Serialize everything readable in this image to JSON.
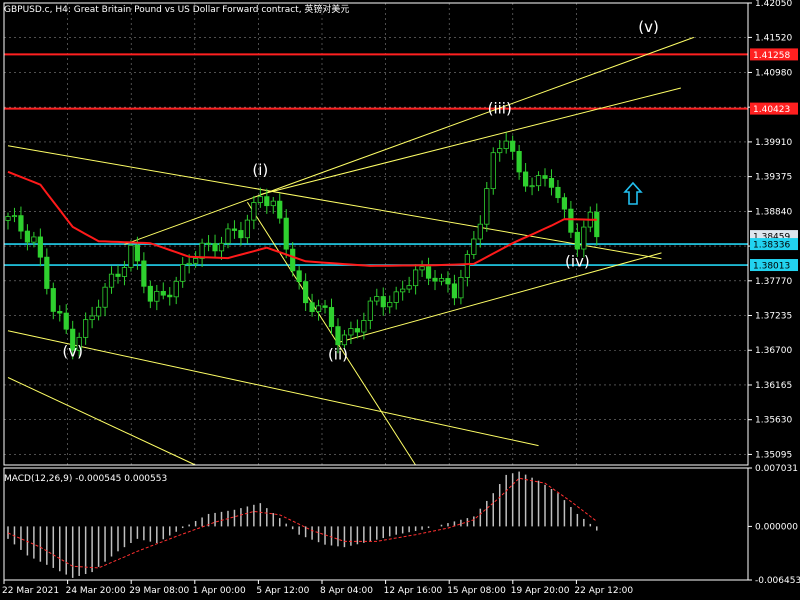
{
  "header": {
    "title": "GBPUSD.c, H4:  Great Britain Pound vs US Dollar Forward contract, 英镑对美元"
  },
  "colors": {
    "background": "#000000",
    "grid": "#7f7f7f",
    "up_candle": "#2fd02f",
    "down_candle": "#2fd02f",
    "moving_average": "#ff1a1a",
    "trendline": "#ffff66",
    "resistance": "#ff2020",
    "support": "#22d3f0",
    "text": "#ffffff",
    "macd_hist": "#c0c0c0",
    "macd_signal": "#ff3030",
    "arrow": "#22c0f0"
  },
  "macd": {
    "label": "MACD(12,26,9) -0.000545 0.000553",
    "ticks": [
      "0.007031",
      "0.000000",
      "-0.006453"
    ]
  },
  "icons": {
    "up_arrow": "up-arrow-icon"
  },
  "chart_data": {
    "type": "candlestick",
    "symbol": "GBPUSD.c",
    "timeframe": "H4",
    "ylim": [
      1.34932,
      1.4205
    ],
    "y_ticks": [
      "1.42050",
      "1.41520",
      "1.40980",
      "1.40445",
      "1.39910",
      "1.39375",
      "1.38840",
      "1.38305",
      "1.37770",
      "1.37235",
      "1.36700",
      "1.36165",
      "1.35630",
      "1.35095"
    ],
    "x_ticks": [
      "22 Mar 2021",
      "24 Mar 20:00",
      "29 Mar 08:00",
      "1 Apr 00:00",
      "5 Apr 12:00",
      "8 Apr 04:00",
      "12 Apr 16:00",
      "15 Apr 08:00",
      "19 Apr 20:00",
      "22 Apr 12:00"
    ],
    "price_labels": [
      {
        "value": 1.41258,
        "text": "1.41258",
        "kind": "resistance"
      },
      {
        "value": 1.40423,
        "text": "1.40423",
        "kind": "resistance"
      },
      {
        "value": 1.38459,
        "text": "1.38459",
        "kind": "current"
      },
      {
        "value": 1.38336,
        "text": "1.38336",
        "kind": "support"
      },
      {
        "value": 1.38013,
        "text": "1.38013",
        "kind": "support"
      }
    ],
    "wave_labels": [
      {
        "text": "(v)",
        "bar": 10,
        "price": 1.366
      },
      {
        "text": "(i)",
        "bar": 39,
        "price": 1.394
      },
      {
        "text": "(ii)",
        "bar": 51,
        "price": 1.3656
      },
      {
        "text": "(iii)",
        "bar": 76,
        "price": 1.4035
      },
      {
        "text": "(iv)",
        "bar": 88,
        "price": 1.3799
      },
      {
        "text": "(v)",
        "bar": 99,
        "price": 1.416
      }
    ],
    "anchors": [
      {
        "bar": 0,
        "price": 1.387
      },
      {
        "bar": 4,
        "price": 1.3845
      },
      {
        "bar": 7,
        "price": 1.373
      },
      {
        "bar": 10,
        "price": 1.3685
      },
      {
        "bar": 13,
        "price": 1.372
      },
      {
        "bar": 16,
        "price": 1.378
      },
      {
        "bar": 19,
        "price": 1.3825
      },
      {
        "bar": 22,
        "price": 1.3745
      },
      {
        "bar": 26,
        "price": 1.3775
      },
      {
        "bar": 30,
        "price": 1.383
      },
      {
        "bar": 33,
        "price": 1.384
      },
      {
        "bar": 36,
        "price": 1.385
      },
      {
        "bar": 39,
        "price": 1.3915
      },
      {
        "bar": 41,
        "price": 1.389
      },
      {
        "bar": 44,
        "price": 1.38
      },
      {
        "bar": 46,
        "price": 1.3745
      },
      {
        "bar": 48,
        "price": 1.3735
      },
      {
        "bar": 51,
        "price": 1.369
      },
      {
        "bar": 54,
        "price": 1.3705
      },
      {
        "bar": 57,
        "price": 1.3745
      },
      {
        "bar": 60,
        "price": 1.3755
      },
      {
        "bar": 63,
        "price": 1.3785
      },
      {
        "bar": 66,
        "price": 1.379
      },
      {
        "bar": 69,
        "price": 1.3755
      },
      {
        "bar": 71,
        "price": 1.3805
      },
      {
        "bar": 73,
        "price": 1.388
      },
      {
        "bar": 75,
        "price": 1.3965
      },
      {
        "bar": 77,
        "price": 1.3995
      },
      {
        "bar": 79,
        "price": 1.394
      },
      {
        "bar": 82,
        "price": 1.393
      },
      {
        "bar": 84,
        "price": 1.3925
      },
      {
        "bar": 86,
        "price": 1.388
      },
      {
        "bar": 88,
        "price": 1.384
      },
      {
        "bar": 90,
        "price": 1.387
      },
      {
        "bar": 91,
        "price": 1.3846
      }
    ],
    "moving_average": [
      {
        "bar": 0,
        "price": 1.3945
      },
      {
        "bar": 5,
        "price": 1.3925
      },
      {
        "bar": 10,
        "price": 1.386
      },
      {
        "bar": 14,
        "price": 1.3838
      },
      {
        "bar": 22,
        "price": 1.3835
      },
      {
        "bar": 28,
        "price": 1.3814
      },
      {
        "bar": 34,
        "price": 1.3812
      },
      {
        "bar": 40,
        "price": 1.3828
      },
      {
        "bar": 46,
        "price": 1.3807
      },
      {
        "bar": 56,
        "price": 1.38
      },
      {
        "bar": 66,
        "price": 1.3801
      },
      {
        "bar": 72,
        "price": 1.3803
      },
      {
        "bar": 78,
        "price": 1.3835
      },
      {
        "bar": 84,
        "price": 1.3862
      },
      {
        "bar": 86,
        "price": 1.3872
      },
      {
        "bar": 91,
        "price": 1.3871
      }
    ],
    "trendlines": [
      {
        "from": {
          "bar": 0,
          "price": 1.3985
        },
        "to": {
          "bar": 101,
          "price": 1.3811
        }
      },
      {
        "from": {
          "bar": 18,
          "price": 1.3833
        },
        "to": {
          "bar": 106,
          "price": 1.4152
        }
      },
      {
        "from": {
          "bar": 39,
          "price": 1.391
        },
        "to": {
          "bar": 104,
          "price": 1.4074
        }
      },
      {
        "from": {
          "bar": 51,
          "price": 1.3682
        },
        "to": {
          "bar": 101,
          "price": 1.382
        }
      },
      {
        "from": {
          "bar": 37,
          "price": 1.3898
        },
        "to": {
          "bar": 63,
          "price": 1.3493
        }
      },
      {
        "from": {
          "bar": 0,
          "price": 1.37
        },
        "to": {
          "bar": 82,
          "price": 1.3523
        }
      },
      {
        "from": {
          "bar": 0,
          "price": 1.3628
        },
        "to": {
          "bar": 29,
          "price": 1.3493
        }
      }
    ],
    "macd_hist": [
      {
        "bar": 0,
        "value": -0.0015
      },
      {
        "bar": 3,
        "value": -0.0035
      },
      {
        "bar": 7,
        "value": -0.005
      },
      {
        "bar": 10,
        "value": -0.0062
      },
      {
        "bar": 13,
        "value": -0.0055
      },
      {
        "bar": 17,
        "value": -0.003
      },
      {
        "bar": 20,
        "value": -0.0015
      },
      {
        "bar": 23,
        "value": -0.002
      },
      {
        "bar": 27,
        "value": -0.0002
      },
      {
        "bar": 31,
        "value": 0.0015
      },
      {
        "bar": 35,
        "value": 0.002
      },
      {
        "bar": 39,
        "value": 0.0028
      },
      {
        "bar": 42,
        "value": 0.001
      },
      {
        "bar": 45,
        "value": -0.001
      },
      {
        "bar": 49,
        "value": -0.0022
      },
      {
        "bar": 52,
        "value": -0.0025
      },
      {
        "bar": 56,
        "value": -0.0018
      },
      {
        "bar": 60,
        "value": -0.001
      },
      {
        "bar": 64,
        "value": -0.0004
      },
      {
        "bar": 68,
        "value": 0.0004
      },
      {
        "bar": 72,
        "value": 0.0012
      },
      {
        "bar": 75,
        "value": 0.004
      },
      {
        "bar": 77,
        "value": 0.0062
      },
      {
        "bar": 79,
        "value": 0.0066
      },
      {
        "bar": 82,
        "value": 0.0055
      },
      {
        "bar": 85,
        "value": 0.004
      },
      {
        "bar": 88,
        "value": 0.0015
      },
      {
        "bar": 90,
        "value": 0.0003
      },
      {
        "bar": 91,
        "value": -0.0005
      }
    ],
    "macd_signal": [
      {
        "bar": 0,
        "value": -0.0008
      },
      {
        "bar": 5,
        "value": -0.0025
      },
      {
        "bar": 10,
        "value": -0.0048
      },
      {
        "bar": 14,
        "value": -0.005
      },
      {
        "bar": 20,
        "value": -0.003
      },
      {
        "bar": 26,
        "value": -0.0012
      },
      {
        "bar": 32,
        "value": 0.0005
      },
      {
        "bar": 38,
        "value": 0.0018
      },
      {
        "bar": 42,
        "value": 0.0014
      },
      {
        "bar": 47,
        "value": -0.0005
      },
      {
        "bar": 52,
        "value": -0.0018
      },
      {
        "bar": 57,
        "value": -0.0018
      },
      {
        "bar": 63,
        "value": -0.001
      },
      {
        "bar": 68,
        "value": -0.0002
      },
      {
        "bar": 72,
        "value": 0.0008
      },
      {
        "bar": 76,
        "value": 0.0035
      },
      {
        "bar": 79,
        "value": 0.0058
      },
      {
        "bar": 83,
        "value": 0.0052
      },
      {
        "bar": 87,
        "value": 0.003
      },
      {
        "bar": 91,
        "value": 0.0006
      }
    ]
  }
}
